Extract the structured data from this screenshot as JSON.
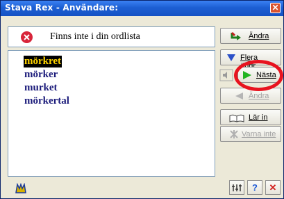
{
  "window": {
    "title": "Stava Rex - Användare:",
    "close_icon": "close-x"
  },
  "status": {
    "text": "Finns inte i din ordlista",
    "icon": "stop-icon"
  },
  "suggestions": [
    "mörkret",
    "mörker",
    "murket",
    "mörkertal"
  ],
  "selected_index": 0,
  "buttons": {
    "andra": "Ändra",
    "flera": "Flera ändr...",
    "nasta": "Nästa",
    "andra_back": "Ändra",
    "lar_in": "Lär in",
    "varna_inte": "Varna inte"
  },
  "bottom": {
    "help": "?",
    "close": "✕",
    "settings": "settings-icon",
    "logo": "rex-logo-icon"
  },
  "colors": {
    "accent_red": "#e8131f",
    "title_blue": "#1d5fd3"
  }
}
